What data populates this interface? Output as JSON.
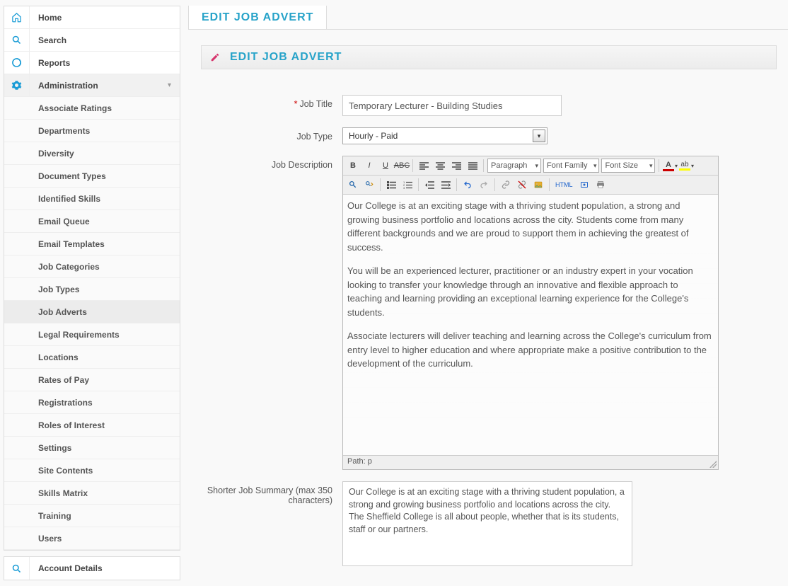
{
  "sidebar": {
    "primary": [
      {
        "icon": "home",
        "label": "Home"
      },
      {
        "icon": "search",
        "label": "Search"
      },
      {
        "icon": "reports",
        "label": "Reports"
      },
      {
        "icon": "gear",
        "label": "Administration",
        "expandable": true
      }
    ],
    "admin_items": [
      "Associate Ratings",
      "Departments",
      "Diversity",
      "Document Types",
      "Identified Skills",
      "Email Queue",
      "Email Templates",
      "Job Categories",
      "Job Types",
      "Job Adverts",
      "Legal Requirements",
      "Locations",
      "Rates of Pay",
      "Registrations",
      "Roles of Interest",
      "Settings",
      "Site Contents",
      "Skills Matrix",
      "Training",
      "Users"
    ],
    "admin_active_index": 9,
    "secondary": [
      {
        "icon": "search",
        "label": "Account Details"
      }
    ]
  },
  "tab": {
    "label": "Edit Job Advert"
  },
  "panel": {
    "title": "Edit Job Advert"
  },
  "form": {
    "job_title": {
      "label": "Job Title",
      "required": true,
      "value": "Temporary Lecturer - Building Studies"
    },
    "job_type": {
      "label": "Job Type",
      "value": "Hourly - Paid"
    },
    "job_description": {
      "label": "Job Description",
      "toolbar": {
        "paragraph": "Paragraph",
        "font_family": "Font Family",
        "font_size": "Font Size"
      },
      "paragraphs": [
        "Our College is at an exciting stage with a thriving student population, a strong and growing business portfolio and locations across the city. Students come from many different backgrounds and we are proud to support them in achieving the greatest of success.",
        "You will be an experienced lecturer, practitioner or an industry expert in your vocation looking to transfer your knowledge through an innovative and flexible approach to teaching and learning providing an exceptional learning experience for the College's students.",
        "Associate lecturers will deliver teaching and learning across the College's curriculum from entry level to higher education and where appropriate make a positive contribution to the development of the curriculum."
      ],
      "status_path": "Path: p"
    },
    "short_summary": {
      "label": "Shorter Job Summary (max 350 characters)",
      "value": "Our College is at an exciting stage with a thriving student population, a strong and growing business portfolio and locations across the city. The Sheffield College is all about people, whether that is its students, staff or our partners."
    }
  }
}
